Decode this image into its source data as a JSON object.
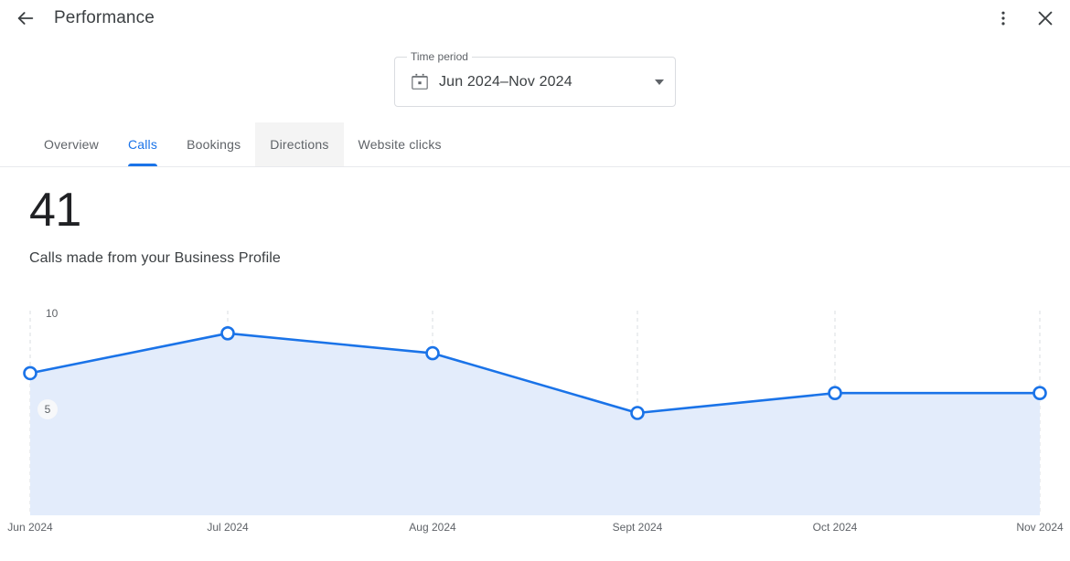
{
  "header": {
    "back_icon": "arrow-back-icon",
    "title": "Performance",
    "more_icon": "more-vert-icon",
    "close_icon": "close-icon"
  },
  "time_period": {
    "legend": "Time period",
    "value": "Jun 2024–Nov 2024",
    "calendar_icon": "calendar-icon",
    "dropdown_icon": "chevron-down-icon"
  },
  "tabs": [
    {
      "label": "Overview",
      "state": "default"
    },
    {
      "label": "Calls",
      "state": "active"
    },
    {
      "label": "Bookings",
      "state": "default"
    },
    {
      "label": "Directions",
      "state": "hovered"
    },
    {
      "label": "Website clicks",
      "state": "default"
    }
  ],
  "metric": {
    "value": "41",
    "label": "Calls made from your Business Profile"
  },
  "colors": {
    "accent": "#1a73e8",
    "line": "#1a73e8",
    "area_fill": "#e3ecfb",
    "gridline": "#dadce0",
    "text_primary": "#202124",
    "text_secondary": "#5f6368"
  },
  "chart_data": {
    "type": "line",
    "title": "Calls made from your Business Profile",
    "xlabel": "",
    "ylabel": "",
    "categories": [
      "Jun 2024",
      "Jul 2024",
      "Aug 2024",
      "Sept 2024",
      "Oct 2024",
      "Nov 2024"
    ],
    "series": [
      {
        "name": "Calls",
        "values": [
          7,
          9,
          8,
          5,
          6,
          6
        ]
      }
    ],
    "total": 41,
    "ylim": [
      0,
      11
    ],
    "y_ticks": [
      5,
      10
    ],
    "y_tick_labels": [
      "5",
      "10"
    ],
    "grid": "vertical-dashed",
    "legend": "none",
    "markers": "open-circle",
    "area_filled": true
  }
}
